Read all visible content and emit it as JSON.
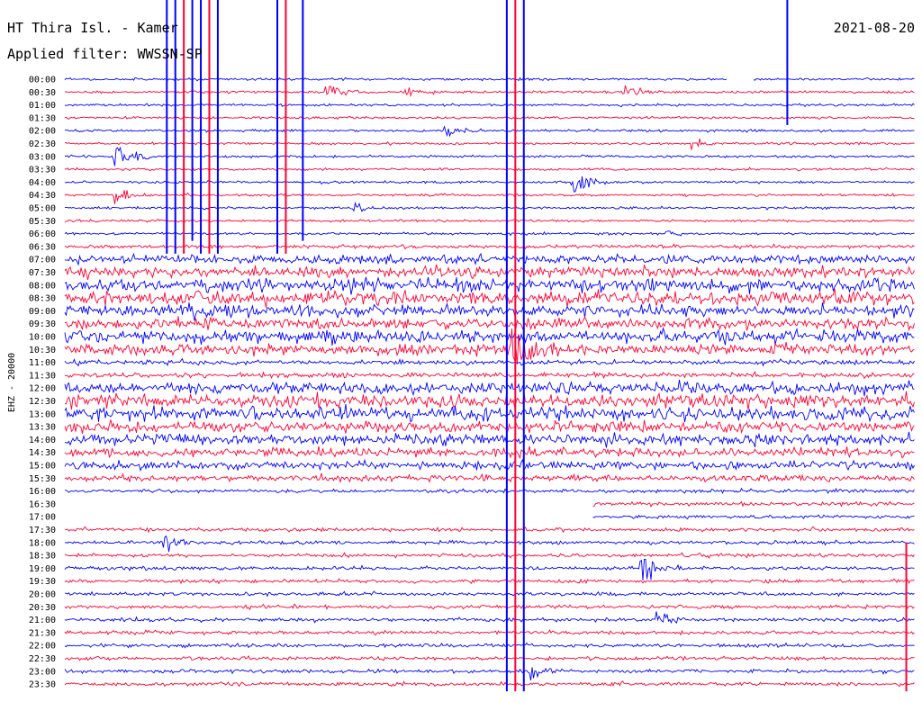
{
  "chart_data": {
    "type": "line",
    "title": "HT Thira Isl. - Kamer",
    "date": "2021-08-20",
    "filter_text": "Applied filter: WWSSN-SP",
    "ylabel": "EHZ - 20000",
    "colors": {
      "trace_a": "#0000ff",
      "trace_b": "#ff0033",
      "background": "#ffffff"
    },
    "row_labels": [
      "00:00",
      "00:30",
      "01:00",
      "01:30",
      "02:00",
      "02:30",
      "03:00",
      "03:30",
      "04:00",
      "04:30",
      "05:00",
      "05:30",
      "06:00",
      "06:30",
      "07:00",
      "07:30",
      "08:00",
      "08:30",
      "09:00",
      "09:30",
      "10:00",
      "10:30",
      "11:00",
      "11:30",
      "12:00",
      "12:30",
      "13:00",
      "13:30",
      "14:00",
      "14:30",
      "15:00",
      "15:30",
      "16:00",
      "16:30",
      "17:00",
      "17:30",
      "18:00",
      "18:30",
      "19:00",
      "19:30",
      "20:00",
      "20:30",
      "21:00",
      "21:30",
      "22:00",
      "22:30",
      "23:00",
      "23:30"
    ],
    "noise_level": [
      2,
      2,
      2,
      2,
      2,
      2,
      2,
      2,
      2,
      2,
      2,
      2,
      2,
      3,
      7,
      9,
      11,
      11,
      9,
      9,
      11,
      9,
      4,
      4,
      9,
      11,
      11,
      9,
      9,
      7,
      7,
      5,
      3,
      3,
      3,
      3,
      3,
      3,
      3,
      3,
      3,
      3,
      3,
      3,
      3,
      3,
      3,
      3
    ],
    "events": [
      {
        "row": 1,
        "x": 0.31,
        "amp": 14
      },
      {
        "row": 1,
        "x": 0.4,
        "amp": 8
      },
      {
        "row": 1,
        "x": 0.66,
        "amp": 12
      },
      {
        "row": 4,
        "x": 0.45,
        "amp": 8
      },
      {
        "row": 5,
        "x": 0.74,
        "amp": 8
      },
      {
        "row": 6,
        "x": 0.06,
        "amp": 30
      },
      {
        "row": 8,
        "x": 0.6,
        "amp": 22
      },
      {
        "row": 9,
        "x": 0.06,
        "amp": 14
      },
      {
        "row": 10,
        "x": 0.34,
        "amp": 8
      },
      {
        "row": 12,
        "x": 0.71,
        "amp": 6
      },
      {
        "row": 18,
        "x": 0.15,
        "amp": 10
      },
      {
        "row": 21,
        "x": 0.53,
        "amp": 40
      },
      {
        "row": 36,
        "x": 0.12,
        "amp": 12
      },
      {
        "row": 38,
        "x": 0.68,
        "amp": 26
      },
      {
        "row": 42,
        "x": 0.7,
        "amp": 14
      },
      {
        "row": 46,
        "x": 0.55,
        "amp": 14
      }
    ],
    "spikes": [
      {
        "x": 0.12,
        "from_row": 0,
        "to_row": 13
      },
      {
        "x": 0.13,
        "from_row": 0,
        "to_row": 13
      },
      {
        "x": 0.14,
        "from_row": 0,
        "to_row": 13
      },
      {
        "x": 0.15,
        "from_row": 0,
        "to_row": 12
      },
      {
        "x": 0.16,
        "from_row": 0,
        "to_row": 13
      },
      {
        "x": 0.17,
        "from_row": 0,
        "to_row": 13
      },
      {
        "x": 0.18,
        "from_row": 0,
        "to_row": 13
      },
      {
        "x": 0.25,
        "from_row": 0,
        "to_row": 13
      },
      {
        "x": 0.26,
        "from_row": 0,
        "to_row": 13
      },
      {
        "x": 0.28,
        "from_row": 0,
        "to_row": 12
      },
      {
        "x": 0.52,
        "from_row": 0,
        "to_row": 47
      },
      {
        "x": 0.53,
        "from_row": 0,
        "to_row": 47
      },
      {
        "x": 0.54,
        "from_row": 0,
        "to_row": 47
      },
      {
        "x": 0.85,
        "from_row": 0,
        "to_row": 3
      },
      {
        "x": 0.99,
        "from_row": 36,
        "to_row": 47
      }
    ],
    "gaps": [
      {
        "row": 0,
        "x_from": 0.78,
        "x_to": 0.81
      },
      {
        "row": 33,
        "x_from": 0.0,
        "x_to": 0.62
      },
      {
        "row": 34,
        "x_from": 0.0,
        "x_to": 0.62
      }
    ]
  }
}
